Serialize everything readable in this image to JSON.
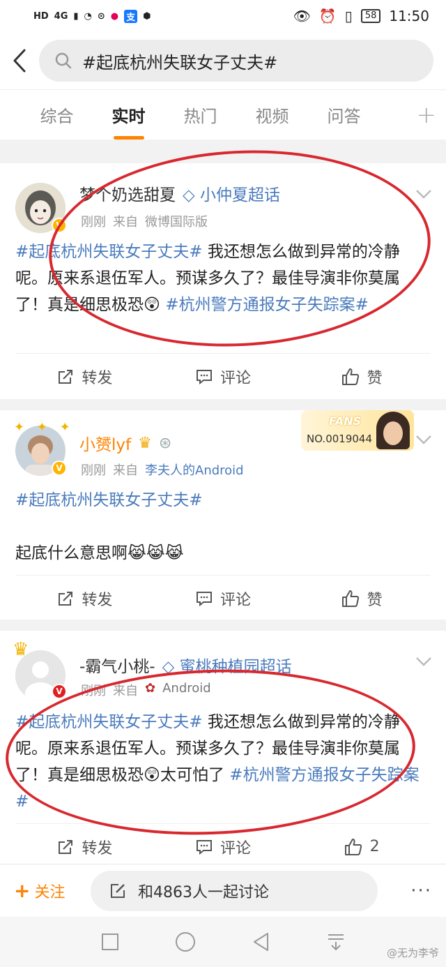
{
  "status_bar": {
    "left_label": "HD",
    "signal_label": "4G",
    "battery": "58",
    "time": "11:50"
  },
  "search": {
    "query": "#起底杭州失联女子丈夫#"
  },
  "tabs": [
    {
      "label": "综合",
      "active": false
    },
    {
      "label": "实时",
      "active": true
    },
    {
      "label": "热门",
      "active": false
    },
    {
      "label": "视频",
      "active": false
    },
    {
      "label": "问答",
      "active": false
    }
  ],
  "posts": [
    {
      "author": "梦个奶选甜夏",
      "supertopic": "小仲夏超话",
      "time": "刚刚",
      "source_prefix": "来自",
      "source": "微博国际版",
      "text_segments": [
        {
          "type": "tag",
          "text": "#起底杭州失联女子丈夫#"
        },
        {
          "type": "text",
          "text": " 我还想怎么做到异常的冷静呢。原来系退伍军人。预谋多久了？最佳导演非你莫属了！真是细思极恐😲 "
        },
        {
          "type": "tag",
          "text": "#杭州警方通报女子失踪案#"
        }
      ],
      "actions": {
        "repost": "转发",
        "comment": "评论",
        "like": "赞"
      }
    },
    {
      "author": "小赟lyf",
      "time": "刚刚",
      "source_prefix": "来自",
      "source": "李夫人的Android",
      "fans_badge": {
        "title": "FANS",
        "number": "NO.0019044"
      },
      "tag_line": "#起底杭州失联女子丈夫#",
      "text": "起底什么意思啊😹😹😹",
      "actions": {
        "repost": "转发",
        "comment": "评论",
        "like": "赞"
      }
    },
    {
      "author": "-霸气小桃-",
      "supertopic": "蜜桃种植园超话",
      "time": "刚刚",
      "source_prefix": "来自",
      "source": "Android",
      "text_segments": [
        {
          "type": "tag",
          "text": "#起底杭州失联女子丈夫#"
        },
        {
          "type": "text",
          "text": " 我还想怎么做到异常的冷静呢。原来系退伍军人。预谋多久了？最佳导演非你莫属了！真是细思极恐😲太可怕了 "
        },
        {
          "type": "tag",
          "text": "#杭州警方通报女子失踪案#"
        }
      ],
      "actions": {
        "repost": "转发",
        "comment": "评论",
        "like": "2"
      }
    }
  ],
  "bottom_bar": {
    "follow": "关注",
    "discuss": "和4863人一起讨论",
    "more": "···"
  },
  "watermark": "@无为李爷",
  "colors": {
    "accent": "#ff8200",
    "link": "#4a7bbd",
    "annotation": "#d8282f"
  }
}
